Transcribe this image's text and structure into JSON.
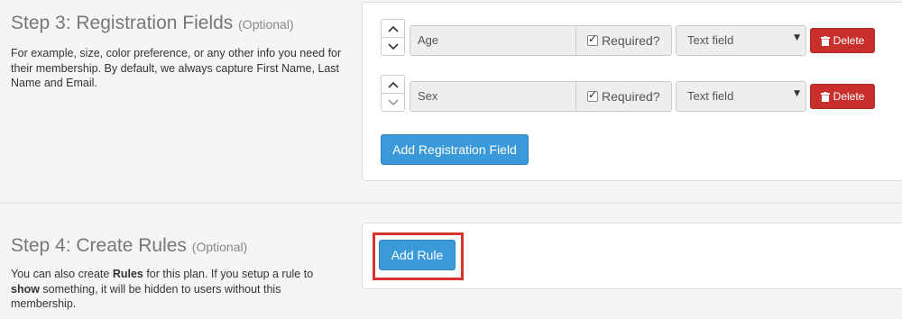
{
  "step3": {
    "title": "Step 3: Registration Fields",
    "optional": "(Optional)",
    "description": "For example, size, color preference, or any other info you need for their membership. By default, we always capture First Name, Last Name and Email.",
    "fields": [
      {
        "name": "Age",
        "required_label": "Required?",
        "required": true,
        "type": "Text field",
        "delete_label": "Delete"
      },
      {
        "name": "Sex",
        "required_label": "Required?",
        "required": true,
        "type": "Text field",
        "delete_label": "Delete"
      }
    ],
    "add_field_label": "Add Registration Field"
  },
  "step4": {
    "title": "Step 4: Create Rules",
    "optional": "(Optional)",
    "description_parts": {
      "p1": "You can also create ",
      "b1": "Rules",
      "p2": " for this plan. If you setup a rule to ",
      "b2": "show",
      "p3": " something, it will be hidden to users without this membership."
    },
    "add_rule_label": "Add Rule"
  },
  "colors": {
    "primary": "#3a9ad9",
    "danger": "#c9302c",
    "highlight": "#d9342b"
  }
}
